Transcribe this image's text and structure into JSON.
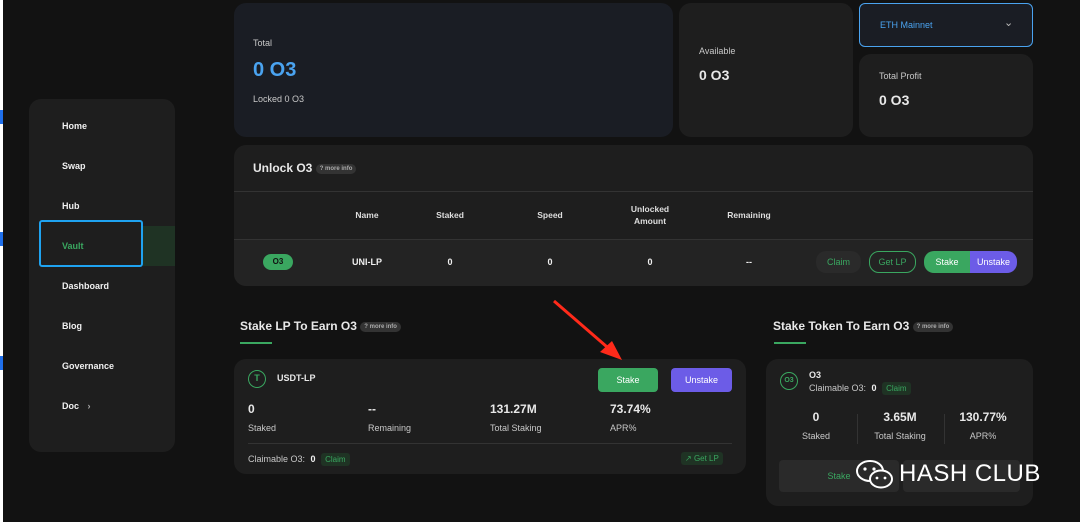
{
  "sidebar": {
    "items": [
      {
        "label": "Home"
      },
      {
        "label": "Swap"
      },
      {
        "label": "Hub"
      },
      {
        "label": "Vault"
      },
      {
        "label": "Dashboard"
      },
      {
        "label": "Blog"
      },
      {
        "label": "Governance"
      },
      {
        "label": "Doc"
      }
    ]
  },
  "summary": {
    "total_label": "Total",
    "total_value": "0 O3",
    "locked": "Locked 0 O3",
    "available_label": "Available",
    "available_value": "0 O3",
    "network": "ETH Mainnet",
    "total_profit_label": "Total Profit",
    "total_profit_value": "0 O3"
  },
  "unlock": {
    "title": "Unlock O3",
    "more_info": "more info",
    "headers": [
      "Name",
      "Staked",
      "Speed",
      "Unlocked Amount",
      "Remaining"
    ],
    "row": {
      "icon_text": "O3",
      "name": "UNI-LP",
      "staked": "0",
      "speed": "0",
      "unlocked": "0",
      "remaining": "--"
    },
    "buttons": {
      "claim": "Claim",
      "get_lp": "Get LP",
      "stake": "Stake",
      "unstake": "Unstake"
    }
  },
  "stake_lp": {
    "title": "Stake LP To Earn O3",
    "more_info": "more info",
    "token_icon": "T",
    "token": "USDT-LP",
    "stake": "Stake",
    "unstake": "Unstake",
    "stats": [
      {
        "value": "0",
        "label": "Staked"
      },
      {
        "value": "--",
        "label": "Remaining"
      },
      {
        "value": "131.27M",
        "label": "Total Staking"
      },
      {
        "value": "73.74%",
        "label": "APR%"
      }
    ],
    "claimable_label": "Claimable O3:",
    "claimable_value": "0",
    "claim": "Claim",
    "get_lp": "Get LP"
  },
  "stake_token": {
    "title": "Stake Token To Earn O3",
    "more_info": "more info",
    "token_icon": "O3",
    "token": "O3",
    "claimable_label": "Claimable O3:",
    "claimable_value": "0",
    "claim": "Claim",
    "stats": [
      {
        "value": "0",
        "label": "Staked"
      },
      {
        "value": "3.65M",
        "label": "Total Staking"
      },
      {
        "value": "130.77%",
        "label": "APR%"
      }
    ],
    "stake": "Stake"
  },
  "watermark": {
    "text": "HASH CLUB"
  },
  "colors": {
    "accent_green": "#3aa760",
    "accent_purple": "#6c5ce7",
    "annotation_red": "#ff2a1a",
    "select_border": "#1fa3f0"
  }
}
